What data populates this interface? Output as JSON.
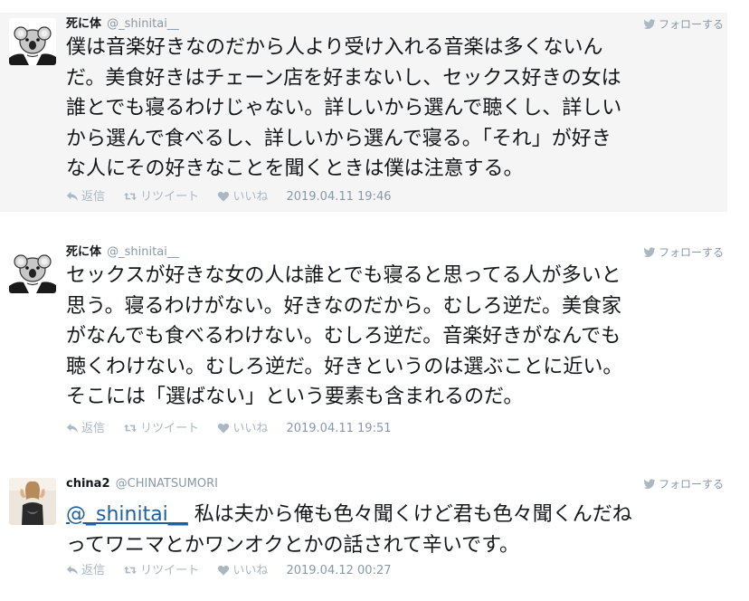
{
  "tweets": [
    {
      "name": "死に体",
      "handle": "@_shinitai__",
      "follow": "フォローする",
      "lines": [
        "僕は音楽好きなのだから人より受け入れる音楽は多くないん",
        "だ。美食好きはチェーン店を好まないし、セックス好きの女は",
        "誰とでも寝るわけじゃない。詳しいから選んで聴くし、詳しい",
        "から選んで食べるし、詳しいから選んで寝る。「それ」が好き",
        "な人にその好きなことを聞くときは僕は注意する。"
      ],
      "reply": "返信",
      "retweet": "リツイート",
      "like": "いいね",
      "date": "2019.04.11 19:46"
    },
    {
      "name": "死に体",
      "handle": "@_shinitai__",
      "follow": "フォローする",
      "lines": [
        "セックスが好きな女の人は誰とでも寝ると思ってる人が多いと",
        "思う。寝るわけがない。好きなのだから。むしろ逆だ。美食家",
        "がなんでも食べるわけない。むしろ逆だ。音楽好きがなんでも",
        "聴くわけない。むしろ逆だ。好きというのは選ぶことに近い。",
        "そこには「選ばない」という要素も含まれるのだ。"
      ],
      "reply": "返信",
      "retweet": "リツイート",
      "like": "いいね",
      "date": "2019.04.11 19:51"
    },
    {
      "name": "china2",
      "handle": "@CHINATSUMORI",
      "follow": "フォローする",
      "mention": "@_shinitai__",
      "line1_rest": " 私は夫から俺も色々聞くけど君も色々聞くんだね",
      "line2": "ってワニマとかワンオクとかの話されて辛いです。",
      "reply": "返信",
      "retweet": "リツイート",
      "like": "いいね",
      "date": "2019.04.12 00:27"
    }
  ],
  "colors": {
    "highlight_bg": "#f5f5f5",
    "mention": "#1b5fa8",
    "meta": "#8899a6",
    "action": "#aab8c2"
  }
}
